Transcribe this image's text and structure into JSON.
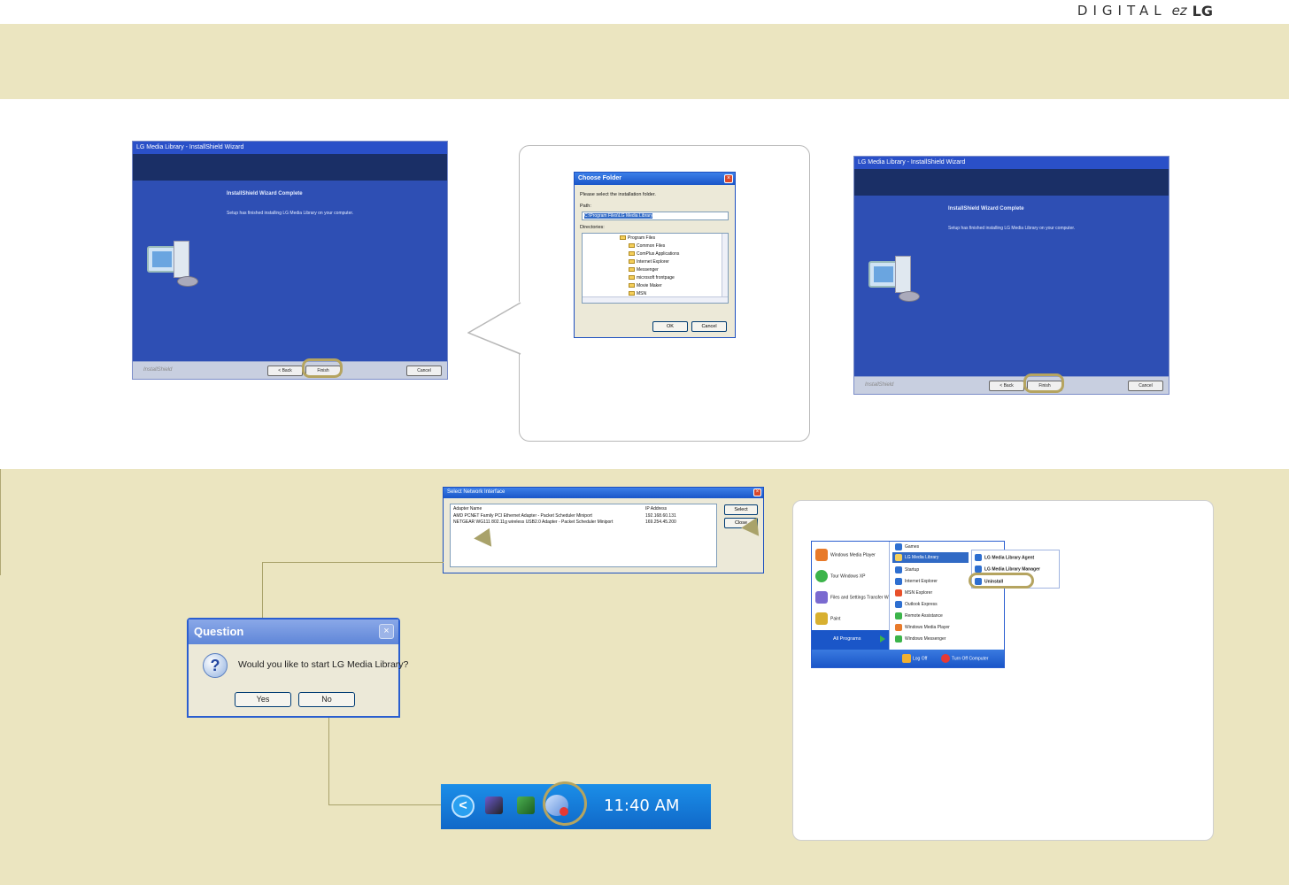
{
  "header": {
    "brand_digital": "DIGITAL",
    "brand_ez": "ez",
    "brand_lg": "LG"
  },
  "wizard": {
    "title": "LG Media Library - InstallShield Wizard",
    "heading": "InstallShield Wizard Complete",
    "message": "Setup has finished installing LG Media Library on your computer.",
    "brand": "InstallShield",
    "back": "< Back",
    "finish": "Finish",
    "cancel": "Cancel"
  },
  "choose_folder": {
    "title": "Choose Folder",
    "prompt": "Please select the installation folder.",
    "path_label": "Path:",
    "path_value": "C:\\Program Files\\LG Media Library",
    "directories_label": "Directories:",
    "directories": [
      "Program Files",
      "Common Files",
      "ComPlus Applications",
      "Internet Explorer",
      "Messenger",
      "microsoft frontpage",
      "Movie Maker",
      "MSN"
    ],
    "ok": "OK",
    "cancel": "Cancel",
    "close": "×"
  },
  "network": {
    "title": "Select Network Interface",
    "col_adapter": "Adapter Name",
    "col_ip": "IP Address",
    "rows": [
      {
        "name": "AMD PCNET Family PCI Ethernet Adapter - Packet Scheduler Miniport",
        "ip": "192.168.60.131"
      },
      {
        "name": "NETGEAR WG111 802.11g wireless USB2.0 Adapter - Packet Scheduler Miniport",
        "ip": "169.254.45.200"
      }
    ],
    "select": "Select",
    "close": "Close",
    "x": "×"
  },
  "question": {
    "title": "Question",
    "message": "Would you like to start LG Media Library?",
    "yes": "Yes",
    "no": "No",
    "icon": "?",
    "x": "×"
  },
  "taskbar": {
    "clock": "11:40 AM",
    "chevron": "<"
  },
  "start_menu": {
    "left_items": [
      "Windows Media Player",
      "Tour Windows XP",
      "Files and Settings Transfer Wizard",
      "Paint"
    ],
    "all_programs": "All Programs",
    "sub_items": [
      "Games",
      "LG Media Library",
      "Startup",
      "Internet Explorer",
      "MSN Explorer",
      "Outlook Express",
      "Remote Assistance",
      "Windows Media Player",
      "Windows Messenger"
    ],
    "lg_items": [
      "LG Media Library Agent",
      "LG Media Library Manager",
      "Uninstall"
    ],
    "log_off": "Log Off",
    "turn_off": "Turn Off Computer"
  }
}
